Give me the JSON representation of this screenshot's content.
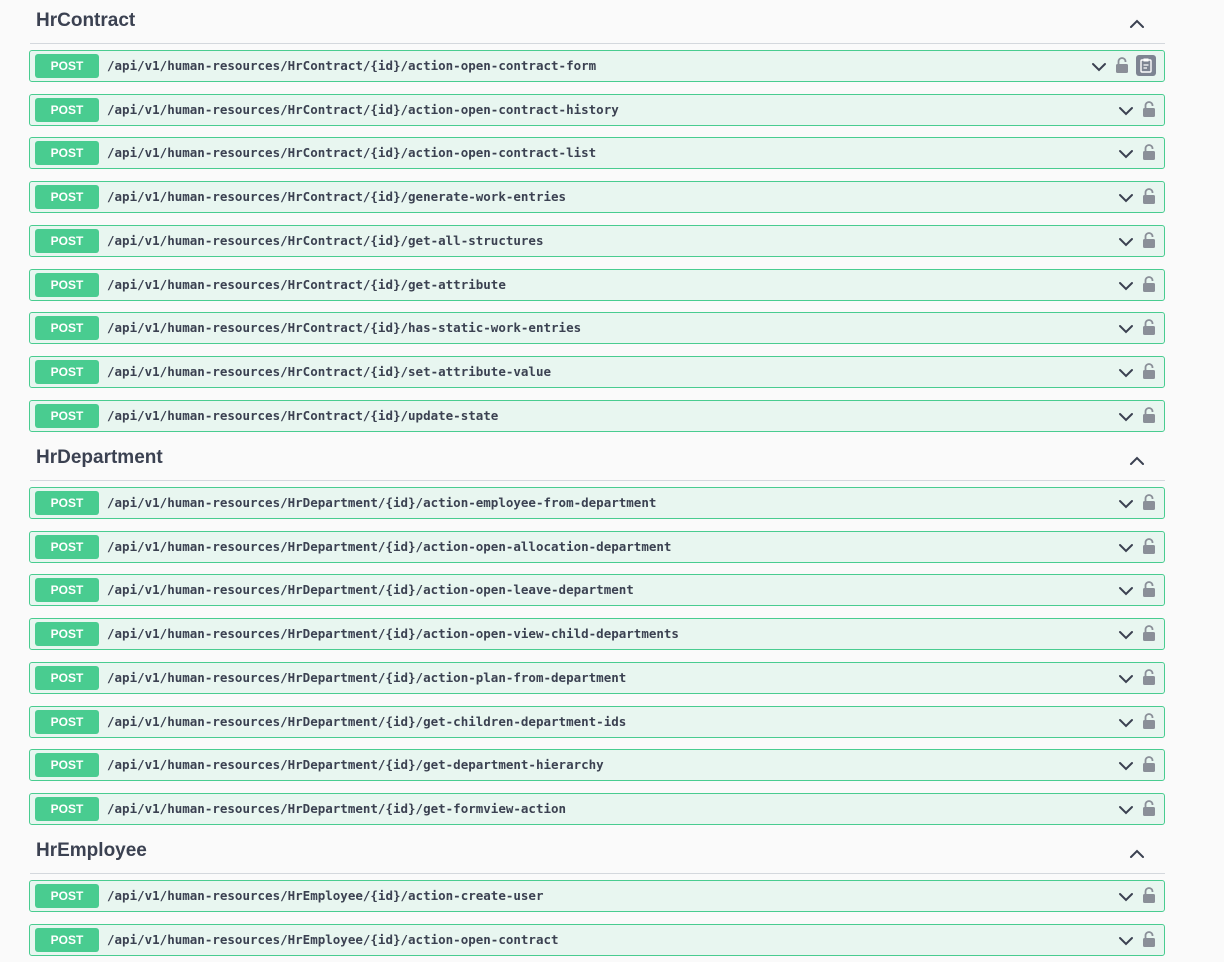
{
  "groups": [
    {
      "name": "HrContract",
      "operations": [
        {
          "method": "POST",
          "path": "/api/v1/human-resources/HrContract/{id}/action-open-contract-form"
        },
        {
          "method": "POST",
          "path": "/api/v1/human-resources/HrContract/{id}/action-open-contract-history"
        },
        {
          "method": "POST",
          "path": "/api/v1/human-resources/HrContract/{id}/action-open-contract-list"
        },
        {
          "method": "POST",
          "path": "/api/v1/human-resources/HrContract/{id}/generate-work-entries"
        },
        {
          "method": "POST",
          "path": "/api/v1/human-resources/HrContract/{id}/get-all-structures"
        },
        {
          "method": "POST",
          "path": "/api/v1/human-resources/HrContract/{id}/get-attribute"
        },
        {
          "method": "POST",
          "path": "/api/v1/human-resources/HrContract/{id}/has-static-work-entries"
        },
        {
          "method": "POST",
          "path": "/api/v1/human-resources/HrContract/{id}/set-attribute-value"
        },
        {
          "method": "POST",
          "path": "/api/v1/human-resources/HrContract/{id}/update-state"
        }
      ]
    },
    {
      "name": "HrDepartment",
      "operations": [
        {
          "method": "POST",
          "path": "/api/v1/human-resources/HrDepartment/{id}/action-employee-from-department"
        },
        {
          "method": "POST",
          "path": "/api/v1/human-resources/HrDepartment/{id}/action-open-allocation-department"
        },
        {
          "method": "POST",
          "path": "/api/v1/human-resources/HrDepartment/{id}/action-open-leave-department"
        },
        {
          "method": "POST",
          "path": "/api/v1/human-resources/HrDepartment/{id}/action-open-view-child-departments"
        },
        {
          "method": "POST",
          "path": "/api/v1/human-resources/HrDepartment/{id}/action-plan-from-department"
        },
        {
          "method": "POST",
          "path": "/api/v1/human-resources/HrDepartment/{id}/get-children-department-ids"
        },
        {
          "method": "POST",
          "path": "/api/v1/human-resources/HrDepartment/{id}/get-department-hierarchy"
        },
        {
          "method": "POST",
          "path": "/api/v1/human-resources/HrDepartment/{id}/get-formview-action"
        }
      ]
    },
    {
      "name": "HrEmployee",
      "operations": [
        {
          "method": "POST",
          "path": "/api/v1/human-resources/HrEmployee/{id}/action-create-user"
        },
        {
          "method": "POST",
          "path": "/api/v1/human-resources/HrEmployee/{id}/action-open-contract"
        }
      ]
    }
  ],
  "icons": {
    "expand": "chevron-down-icon",
    "collapse": "chevron-up-icon",
    "auth": "lock-icon",
    "copy": "clipboard-icon"
  },
  "colors": {
    "post_method_bg": "#49cc90",
    "post_row_bg": "#e8f6f0",
    "text": "#3b4151",
    "icon": "#7d8492"
  }
}
